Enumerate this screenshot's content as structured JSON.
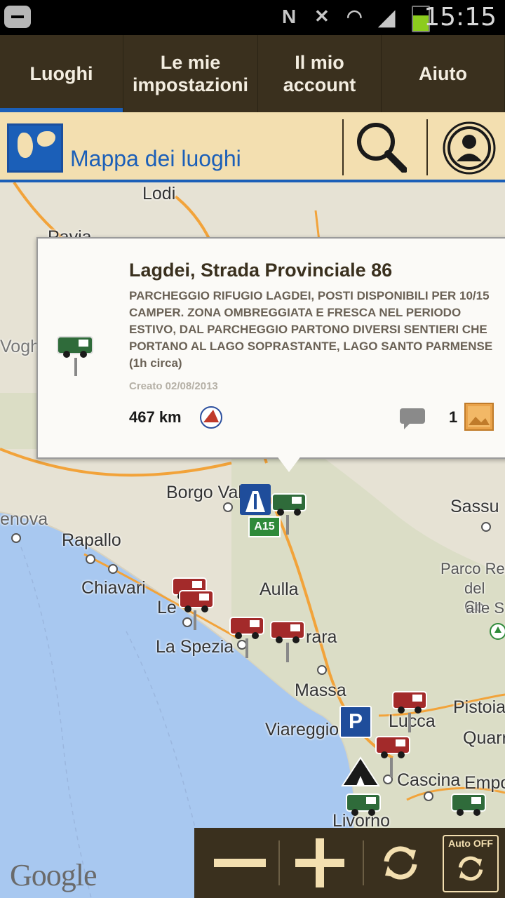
{
  "status_bar": {
    "time": "15:15"
  },
  "tabs": [
    {
      "label": "Luoghi",
      "active": true
    },
    {
      "label": "Le mie impostazioni",
      "active": false
    },
    {
      "label": "Il mio account",
      "active": false
    },
    {
      "label": "Aiuto",
      "active": false
    }
  ],
  "header": {
    "title": "Mappa dei luoghi"
  },
  "map": {
    "places": [
      "Lodi",
      "Pavia",
      "Vogh",
      "Borgo Val",
      "enova",
      "Rapallo",
      "Sassu",
      "Chiavari",
      "Aulla",
      "Le",
      "La Spezia",
      "rara",
      "Massa",
      "Viareggio",
      "Pistoia",
      "Lucca",
      "Quarr",
      "Cascina",
      "Empo",
      "Livorno",
      "Parco Re",
      "del Co",
      "alle S"
    ],
    "highway_label": "A15",
    "attribution": "Google"
  },
  "popup": {
    "title": "Lagdei,  Strada Provinciale 86",
    "description": "PARCHEGGIO RIFUGIO LAGDEI, POSTI DISPONIBILI PER 10/15 CAMPER. ZONA OMBREGGIATA E FRESCA NEL PERIODO ESTIVO, DAL PARCHEGGIO PARTONO DIVERSI SENTIERI CHE PORTANO AL LAGO SOPRASTANTE, LAGO SANTO PARMENSE (1h circa)",
    "created": "Creato 02/08/2013",
    "distance": "467 km",
    "photo_count": "1"
  },
  "controls": {
    "auto_label": "Auto OFF"
  },
  "colors": {
    "accent_blue": "#1b5fb8",
    "bar_brown": "#3a301e",
    "header_sand": "#f3dfb0",
    "camper_red": "#a32a2a",
    "camper_green": "#2f6b3a",
    "sea": "#a8c8f0"
  }
}
